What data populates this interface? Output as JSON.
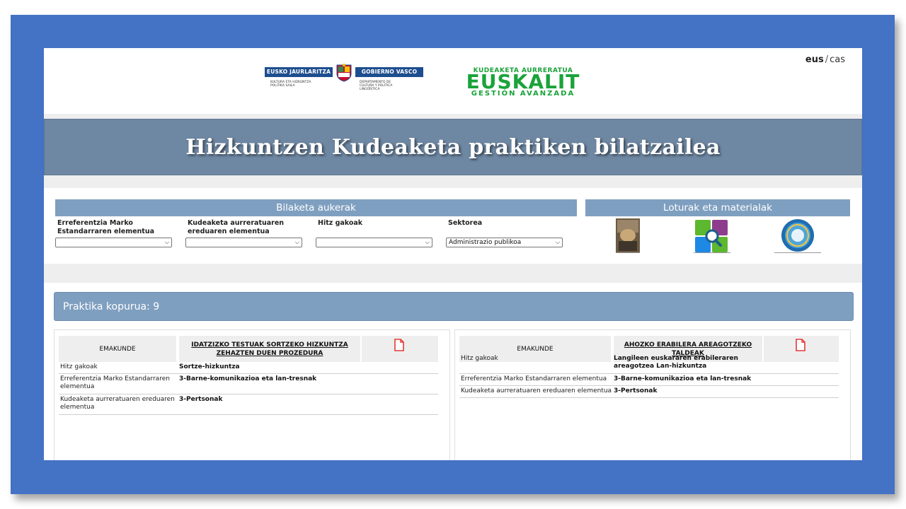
{
  "lang": {
    "active": "eus",
    "separator": "/",
    "other": "cas"
  },
  "gov_logo": {
    "left_text": "EUSKO JAURLARITZA",
    "right_text": "GOBIERNO VASCO",
    "left_sub": "KULTURA ETA HIZKUNTZA POLITIKA SAILA",
    "right_sub": "DEPARTAMENTO DE CULTURA Y POLÍTICA LINGÜÍSTICA"
  },
  "euskalit": {
    "line1": "KUDEAKETA AURRERATUA",
    "line2": "EUSKALIT",
    "line3": "GESTIÓN AVANZADA"
  },
  "title": "Hizkuntzen Kudeaketa praktiken bilatzailea",
  "search": {
    "heading": "Bilaketa aukerak",
    "filters": [
      {
        "label": "Erreferentzia Marko Estandarraren elementua",
        "value": ""
      },
      {
        "label": "Kudeaketa aurreratuaren ereduaren elementua",
        "value": ""
      },
      {
        "label": "Hitz gakoak",
        "value": ""
      },
      {
        "label": "Sektorea",
        "value": "Administrazio publikoa"
      }
    ]
  },
  "links": {
    "heading": "Loturak eta materialak",
    "items": [
      "book-thumbnail",
      "search-app-icon",
      "circle-seal-icon"
    ]
  },
  "count": {
    "label": "Praktika kopurua: 9"
  },
  "cards": [
    {
      "org": "EMAKUNDE",
      "title": "IDATZIZKO TESTUAK SORTZEKO HIZKUNTZA ZEHAZTEN DUEN PROZEDURA",
      "rows": [
        {
          "key": "Hitz gakoak",
          "value": "Sortze-hizkuntza"
        },
        {
          "key": "Erreferentzia Marko Estandarraren elementua",
          "value": "3-Barne-komunikazioa eta lan-tresnak"
        },
        {
          "key": "Kudeaketa aurreratuaren ereduaren elementua",
          "value": "3-Pertsonak"
        }
      ]
    },
    {
      "org": "EMAKUNDE",
      "title": "AHOZKO ERABILERA AREAGOTZEKO TALDEAK",
      "rows": [
        {
          "key": "Hitz gakoak",
          "value": "Langileen euskararen erabileraren areagotzea Lan-hizkuntza"
        },
        {
          "key": "Erreferentzia Marko Estandarraren elementua",
          "value": "3-Barne-komunikazioa eta lan-tresnak"
        },
        {
          "key": "Kudeaketa aurreratuaren ereduaren elementua",
          "value": "3-Pertsonak"
        }
      ]
    }
  ],
  "colors": {
    "frame": "#4472c4",
    "banner": "#6e87a2",
    "section_head": "#7f9fc0",
    "euskalit_green": "#1aa33a",
    "pdf_red": "#e53935"
  }
}
